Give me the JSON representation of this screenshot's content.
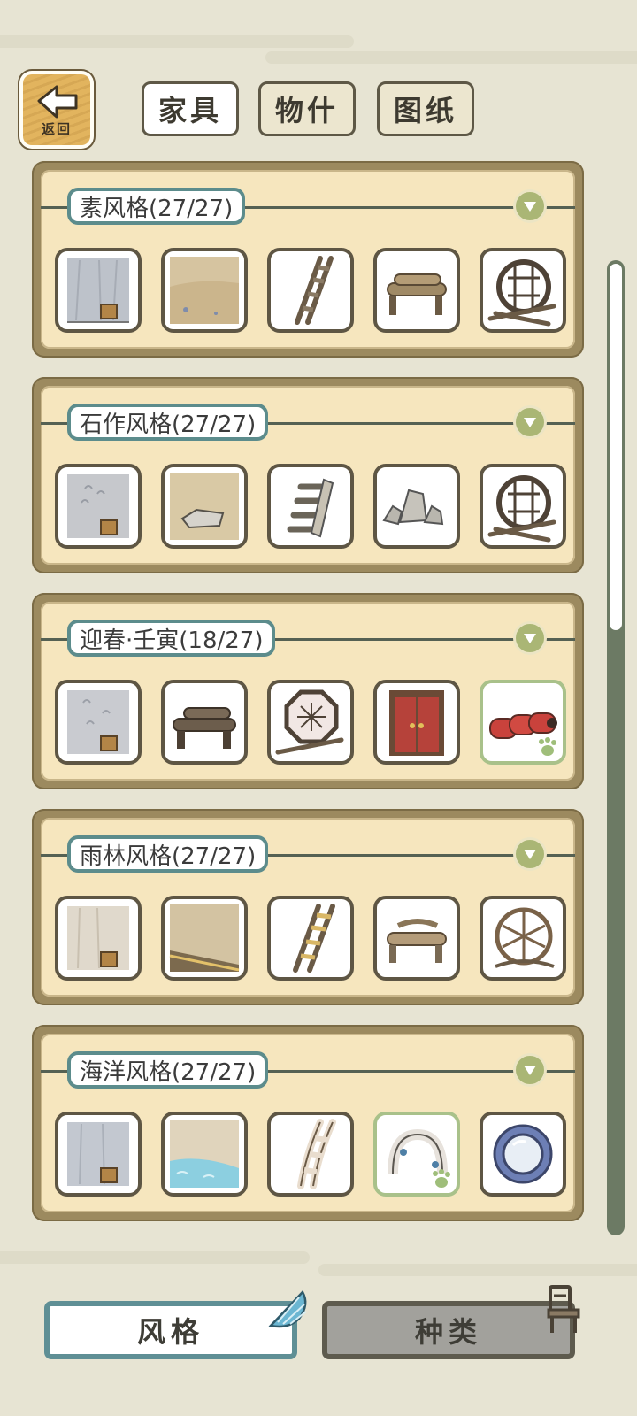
{
  "nav": {
    "back_label": "返回",
    "tabs": [
      {
        "label": "家具",
        "active": true
      },
      {
        "label": "物什",
        "active": false
      },
      {
        "label": "图纸",
        "active": false
      }
    ]
  },
  "sets": [
    {
      "title": "素风格(27/27)",
      "items": [
        {
          "name": "wall"
        },
        {
          "name": "floor"
        },
        {
          "name": "ladder"
        },
        {
          "name": "bench"
        },
        {
          "name": "round-window"
        }
      ]
    },
    {
      "title": "石作风格(27/27)",
      "items": [
        {
          "name": "wall"
        },
        {
          "name": "floor"
        },
        {
          "name": "stone-stairs"
        },
        {
          "name": "rocks"
        },
        {
          "name": "round-window"
        }
      ]
    },
    {
      "title": "迎春·壬寅(18/27)",
      "items": [
        {
          "name": "wall"
        },
        {
          "name": "bench"
        },
        {
          "name": "octagon-window"
        },
        {
          "name": "red-door"
        },
        {
          "name": "firecracker-rolls",
          "new": true
        }
      ]
    },
    {
      "title": "雨林风格(27/27)",
      "items": [
        {
          "name": "wall"
        },
        {
          "name": "floor"
        },
        {
          "name": "ladder"
        },
        {
          "name": "bench"
        },
        {
          "name": "round-window"
        }
      ]
    },
    {
      "title": "海洋风格(27/27)",
      "items": [
        {
          "name": "wall"
        },
        {
          "name": "floor"
        },
        {
          "name": "ladder"
        },
        {
          "name": "shell-arch",
          "new": true
        },
        {
          "name": "porthole"
        }
      ]
    }
  ],
  "bottom": {
    "style_label": "风格",
    "type_label": "种类"
  },
  "colors": {
    "panel_frame": "#9c8a5f",
    "panel_fill": "#f6e6be",
    "title_border": "#5c8c8c",
    "collapse_button": "#aab675",
    "new_item_border": "#a9c18a",
    "scrollbar": "#6c7a64"
  }
}
